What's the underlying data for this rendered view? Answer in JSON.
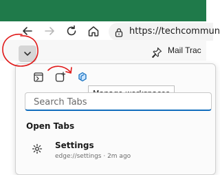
{
  "colors": {
    "top_bar": "#1f7a4a",
    "accent": "#0f6cbd",
    "annotation": "#e01818"
  },
  "toolbar": {
    "icons": [
      "back-arrow-icon",
      "forward-arrow-icon",
      "refresh-icon",
      "home-icon"
    ],
    "url": "https://techcommun"
  },
  "tabstrip": {
    "tab_actions_icon": "chevron-down-icon",
    "pin_icon": "pin-icon",
    "tab_title": "Mail Trac"
  },
  "panel": {
    "buttons": [
      "vertical-tabs-icon",
      "collections-icon",
      "workspaces-icon"
    ],
    "tooltip": "Manage workspaces",
    "search_placeholder": "Search Tabs",
    "section_title": "Open Tabs",
    "tabs": [
      {
        "title": "Settings",
        "subtitle": "edge://settings · 2m ago",
        "icon": "gear-icon"
      }
    ]
  }
}
